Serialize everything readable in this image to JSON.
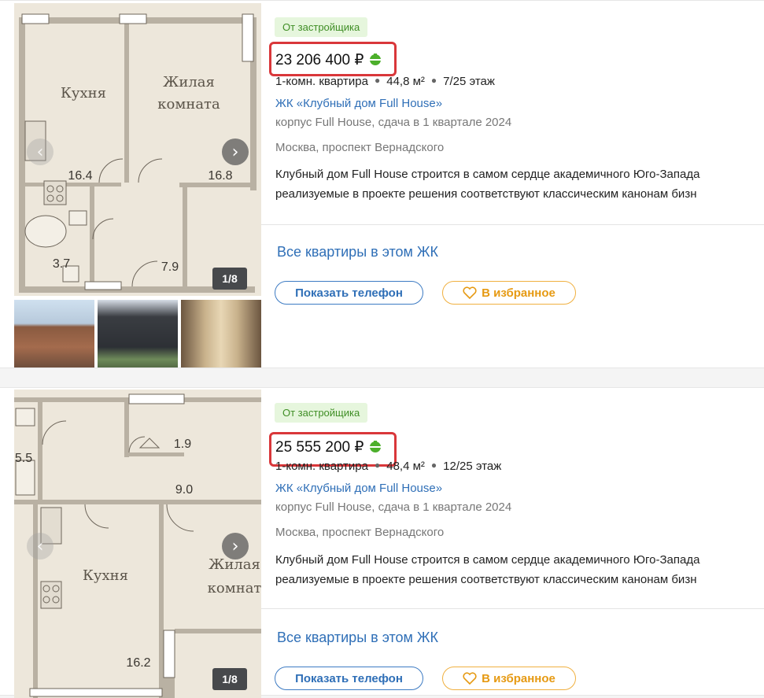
{
  "listings": [
    {
      "badge": "От застройщика",
      "price": "23 206 400 ₽",
      "rooms": "1-комн. квартира",
      "area": "44,8 м²",
      "floor": "7/25 этаж",
      "complex": "ЖК «Клубный дом Full House»",
      "building": "корпус Full House, сдача в 1 квартале 2024",
      "address": "Москва, проспект Вернадского",
      "description_line1": "Клубный дом Full House строится в самом сердце академичного Юго-Запада",
      "description_line2": "реализуемые в проекте решения соответствуют классическим канонам бизн",
      "all_flats_link": "Все квартиры в этом ЖК",
      "phone_button": "Показать телефон",
      "favorite_button": "В избранное",
      "photo_counter": "1/8",
      "plan_labels": {
        "kitchen": "Кухня",
        "living_1": "Жилая",
        "living_2": "комната",
        "kitchen_area": "16.4",
        "living_area": "16.8",
        "bath_area": "3.7",
        "hall_area": "7.9"
      }
    },
    {
      "badge": "От застройщика",
      "price": "25 555 200 ₽",
      "rooms": "1-комн. квартира",
      "area": "48,4 м²",
      "floor": "12/25 этаж",
      "complex": "ЖК «Клубный дом Full House»",
      "building": "корпус Full House, сдача в 1 квартале 2024",
      "address": "Москва, проспект Вернадского",
      "description_line1": "Клубный дом Full House строится в самом сердце академичного Юго-Запада",
      "description_line2": "реализуемые в проекте решения соответствуют классическим канонам бизн",
      "all_flats_link": "Все квартиры в этом ЖК",
      "phone_button": "Показать телефон",
      "favorite_button": "В избранное",
      "photo_counter": "1/8",
      "plan_labels": {
        "kitchen": "Кухня",
        "living_1": "Жилая",
        "living_2": "комнат",
        "bath_area": "5.5",
        "closet_area": "1.9",
        "hall_area": "9.0",
        "kitchen_area": "16.2"
      }
    }
  ],
  "icons": {
    "prev": "chevron-left-icon",
    "next": "chevron-right-icon",
    "helmet": "developer-helmet-icon",
    "heart": "heart-icon"
  },
  "colors": {
    "link": "#2f6fb7",
    "badge_bg": "#e6f6dd",
    "badge_text": "#3f8e25",
    "highlight": "#d9373a",
    "favorite": "#e69a13"
  }
}
